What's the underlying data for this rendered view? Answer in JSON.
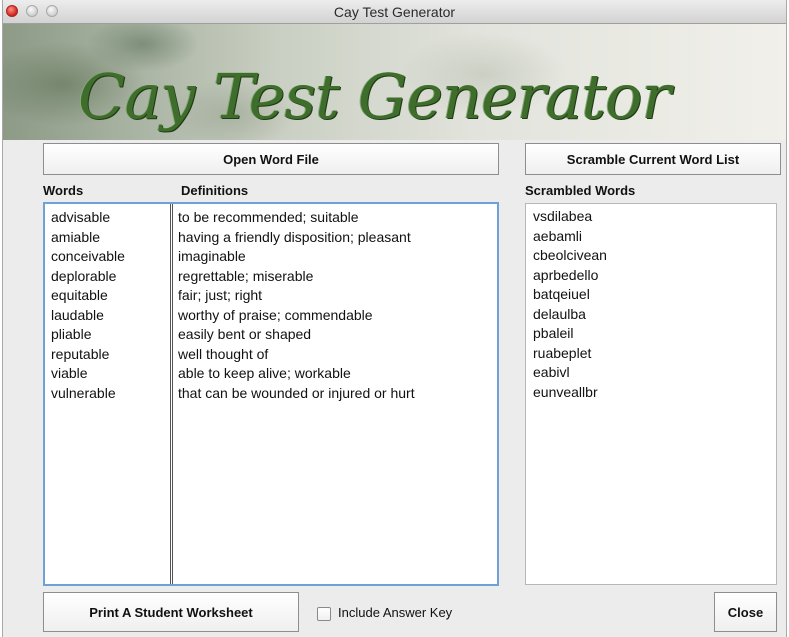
{
  "window": {
    "title": "Cay Test Generator"
  },
  "banner": {
    "title": "Cay Test Generator"
  },
  "buttons": {
    "open_word_file": "Open Word File",
    "scramble": "Scramble Current Word List",
    "print_worksheet": "Print A Student Worksheet",
    "close": "Close"
  },
  "labels": {
    "words": "Words",
    "definitions": "Definitions",
    "scrambled_words": "Scrambled Words"
  },
  "options": {
    "include_answer_key": "Include Answer Key",
    "include_answer_key_checked": false
  },
  "words": [
    "advisable",
    "amiable",
    "conceivable",
    "deplorable",
    "equitable",
    "laudable",
    "pliable",
    "reputable",
    "viable",
    "vulnerable"
  ],
  "definitions": [
    "to be recommended; suitable",
    "having a friendly disposition; pleasant",
    "imaginable",
    "regrettable; miserable",
    "fair; just; right",
    "worthy of praise; commendable",
    "easily bent or shaped",
    "well thought of",
    "able to keep alive; workable",
    "that can be wounded or injured or hurt"
  ],
  "scrambled_words": [
    "vsdilabea",
    "aebamli",
    "cbeolcivean",
    "aprbedello",
    "batqeiuel",
    "delaulba",
    "pbaleil",
    "ruabeplet",
    "eabivl",
    "eunveallbr"
  ]
}
